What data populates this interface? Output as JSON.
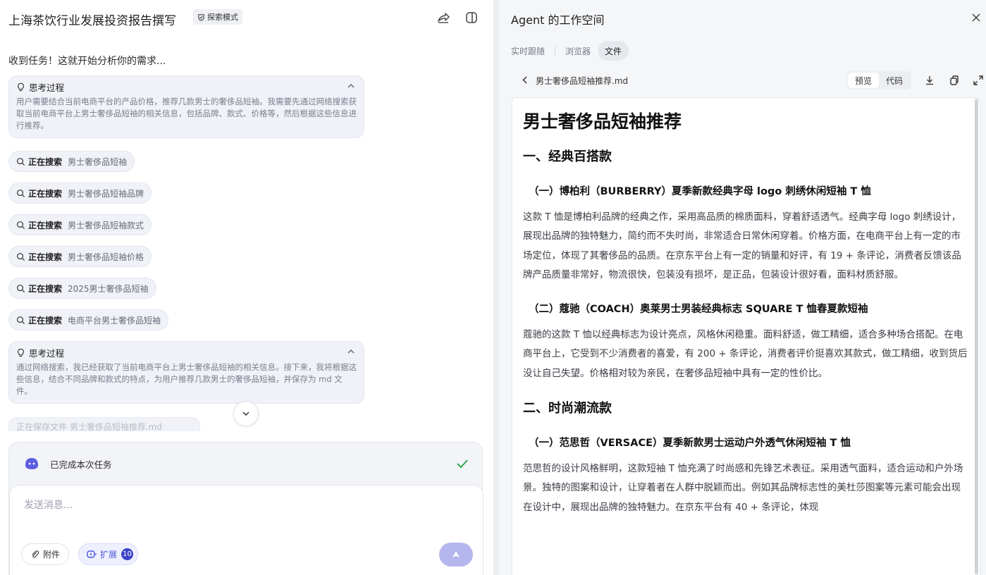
{
  "chat": {
    "title": "上海茶饮行业发展投资报告撰写",
    "mode_badge": "探索模式",
    "intro": "收到任务！这就开始分析你的需求...",
    "thinking_1": {
      "label": "思考过程",
      "text": "用户需要结合当前电商平台的产品价格，推荐几款男士的奢侈品短袖。我需要先通过网络搜索获取当前电商平台上男士奢侈品短袖的相关信息，包括品牌、款式、价格等，然后根据这些信息进行推荐。"
    },
    "searches": [
      {
        "label": "正在搜索",
        "query": "男士奢侈品短袖"
      },
      {
        "label": "正在搜索",
        "query": "男士奢侈品短袖品牌"
      },
      {
        "label": "正在搜索",
        "query": "男士奢侈品短袖款式"
      },
      {
        "label": "正在搜索",
        "query": "男士奢侈品短袖价格"
      },
      {
        "label": "正在搜索",
        "query": "2025男士奢侈品短袖"
      },
      {
        "label": "正在搜索",
        "query": "电商平台男士奢侈品短袖"
      }
    ],
    "thinking_2": {
      "label": "思考过程",
      "text": "通过网络搜索，我已经获取了当前电商平台上男士奢侈品短袖的相关信息。接下来，我将根据这些信息，结合不同品牌和款式的特点，为用户推荐几款男士的奢侈品短袖，并保存为 md 文件。"
    },
    "faded_item": "正在保存文件  男士奢侈品短袖推荐.md",
    "status_text": "已完成本次任务",
    "input_placeholder": "发送消息...",
    "attach_label": "附件",
    "expand_label": "扩展",
    "expand_count": "10"
  },
  "workspace": {
    "title": "Agent 的工作空间",
    "tabs": [
      "实时跟随",
      "浏览器",
      "文件"
    ],
    "active_tab": "文件",
    "file_name": "男士奢侈品短袖推荐.md",
    "view_preview": "预览",
    "view_code": "代码"
  },
  "document": {
    "title": "男士奢侈品短袖推荐",
    "section_1": "一、经典百搭款",
    "item_1_title": "（一）博柏利（BURBERRY）夏季新款经典字母 logo 刺绣休闲短袖 T 恤",
    "item_1_text": "这款 T 恤是博柏利品牌的经典之作，采用高品质的棉质面料，穿着舒适透气。经典字母 logo 刺绣设计，展现出品牌的独特魅力，简约而不失时尚，非常适合日常休闲穿着。价格方面，在电商平台上有一定的市场定位，体现了其奢侈品的品质。在京东平台上有一定的销量和好评，有 19 + 条评论，消费者反馈该品牌产品质量非常好，物流很快，包装没有损坏，是正品，包装设计很好看，面料材质舒服。",
    "item_2_title": "（二）蔻驰（COACH）奥莱男士男装经典标志 SQUARE T 恤春夏款短袖",
    "item_2_text": "蔻驰的这款 T 恤以经典标志为设计亮点，风格休闲稳重。面料舒适，做工精细，适合多种场合搭配。在电商平台上，它受到不少消费者的喜爱，有 200 + 条评论，消费者评价挺喜欢其款式，做工精细，收到货后没让自己失望。价格相对较为亲民，在奢侈品短袖中具有一定的性价比。",
    "section_2": "二、时尚潮流款",
    "item_3_title": "（一）范思哲（VERSACE）夏季新款男士运动户外透气休闲短袖 T 恤",
    "item_3_text": "范思哲的设计风格鲜明，这款短袖 T 恤充满了时尚感和先锋艺术表征。采用透气面料，适合运动和户外场景。独特的图案和设计，让穿着者在人群中脱颖而出。例如其品牌标志性的美杜莎图案等元素可能会出现在设计中，展现出品牌的独特魅力。在京东平台有 40 + 条评论，体现"
  },
  "colors": {
    "accent": "#4c55d8",
    "send_button": "#b6b6ee",
    "success": "#2fa84f",
    "card_bg": "#f0f2f8"
  },
  "icons": {
    "share": "share-icon",
    "layout": "sidebar-toggle-icon",
    "thinking": "lightbulb-icon",
    "search": "search-icon",
    "close": "close-icon",
    "back": "chevron-left-icon",
    "download": "download-icon",
    "copy": "copy-icon",
    "fullscreen": "expand-icon",
    "attach": "paperclip-icon",
    "extension": "plugin-icon",
    "send": "send-arrow-icon",
    "check": "check-icon"
  }
}
